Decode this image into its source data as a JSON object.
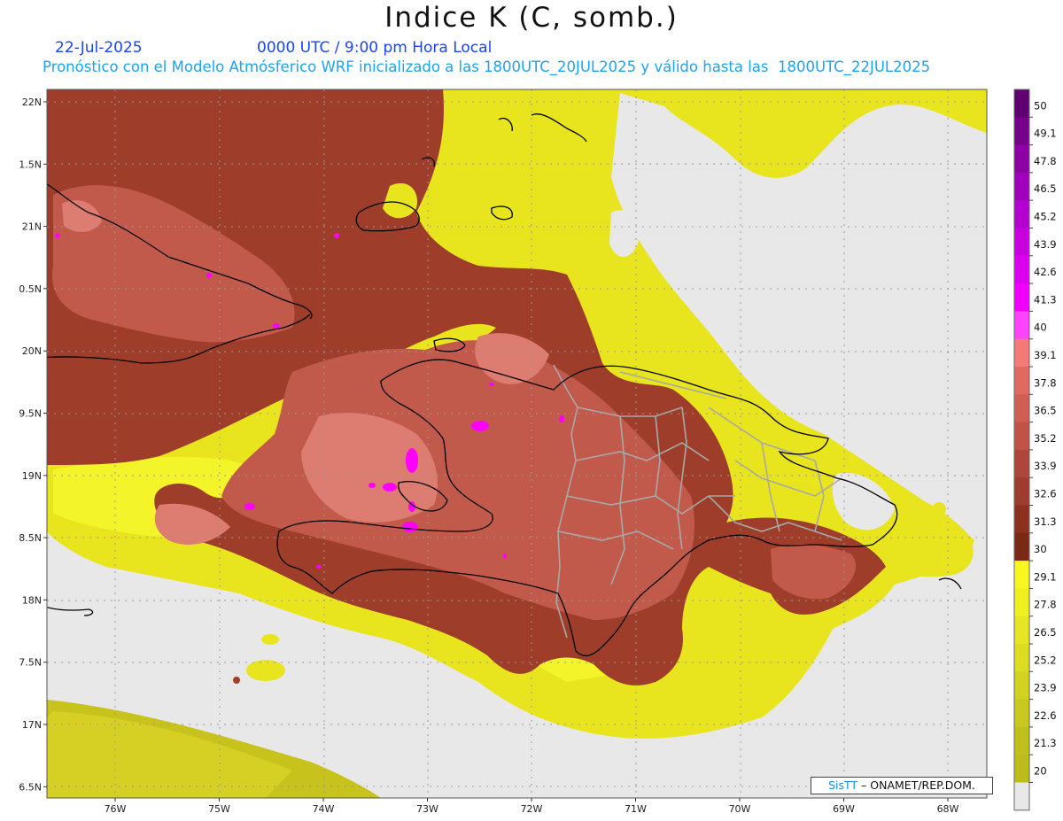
{
  "header": {
    "title": "Indice K (C, somb.)",
    "date": "22-Jul-2025",
    "time": "0000 UTC / 9:00 pm Hora Local",
    "forecast": "Pronóstico con el Modelo Atmósferico WRF inicializado a las 1800UTC_20JUL2025 y válido hasta las  1800UTC_22JUL2025"
  },
  "map": {
    "lat_labels": [
      "22N",
      "1.5N",
      "21N",
      "0.5N",
      "20N",
      "9.5N",
      "19N",
      "8.5N",
      "18N",
      "7.5N",
      "17N",
      "6.5N"
    ],
    "lon_labels": [
      "76W",
      "75W",
      "74W",
      "73W",
      "72W",
      "71W",
      "70W",
      "69W",
      "68W"
    ],
    "colors": {
      "ocean_gray": "#e8e8e8",
      "low_olive": "#c8c21c",
      "mid_yellow": "#e6e62a",
      "bright_yellow": "#f2f226",
      "dark_brown": "#9a3c28",
      "mid_brown": "#b8584a",
      "salmon": "#d8726a",
      "magenta": "#ff00ff",
      "coast": "#000000",
      "provinces": "#a8a8a8"
    }
  },
  "colorbar": {
    "labels": [
      "50",
      "49.1",
      "47.8",
      "46.5",
      "45.2",
      "43.9",
      "42.6",
      "41.3",
      "40",
      "39.1",
      "37.8",
      "36.5",
      "35.2",
      "33.9",
      "32.6",
      "31.3",
      "30",
      "29.1",
      "27.8",
      "26.5",
      "25.2",
      "23.9",
      "22.6",
      "21.3",
      "20"
    ],
    "colors": [
      "#5e0070",
      "#76008c",
      "#8c00a4",
      "#a000bc",
      "#b400d0",
      "#c800e0",
      "#dc00f0",
      "#f000fc",
      "#ff44ff",
      "#f47a78",
      "#e06a62",
      "#d05e54",
      "#c05248",
      "#ae463c",
      "#9e3c30",
      "#8c3020",
      "#7a2a14",
      "#f8f820",
      "#f0f020",
      "#e6e626",
      "#dcdc22",
      "#d2d220",
      "#c8c81e",
      "#c0c01c",
      "#bcbc1a",
      "#e8e8e8"
    ]
  },
  "credit": {
    "brand": "SisTT",
    "rest": "– ONAMET/REP.DOM."
  }
}
